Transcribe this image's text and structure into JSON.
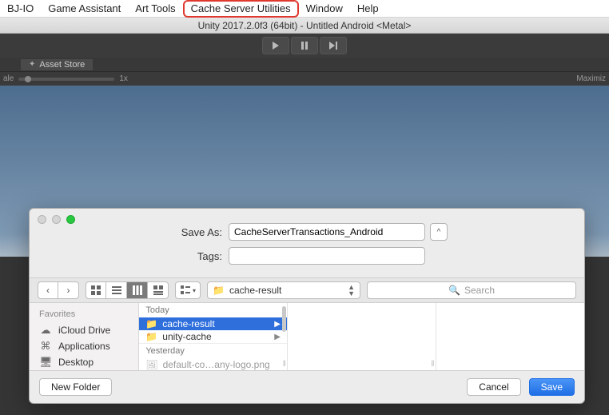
{
  "menubar": {
    "items": [
      "BJ-IO",
      "Game Assistant",
      "Art Tools",
      "Cache Server Utilities",
      "Window",
      "Help"
    ],
    "highlighted_index": 3
  },
  "titlebar": "Unity 2017.2.0f3 (64bit) - Untitled        Android <Metal>",
  "assetstore_tab": "Asset Store",
  "scale": {
    "label_left": "ale",
    "value": "1x",
    "label_right": "Maximiz"
  },
  "save_dialog": {
    "save_as_label": "Save As:",
    "save_as_value": "CacheServerTransactions_Android",
    "tags_label": "Tags:",
    "tags_value": "",
    "expand_caret": "^",
    "path_selector": "cache-result",
    "search_placeholder": "Search",
    "sidebar": {
      "header": "Favorites",
      "items": [
        {
          "icon": "cloud",
          "label": "iCloud Drive"
        },
        {
          "icon": "apps",
          "label": "Applications"
        },
        {
          "icon": "desktop",
          "label": "Desktop"
        }
      ]
    },
    "column1": {
      "groups": [
        {
          "label": "Today",
          "items": [
            {
              "type": "folder",
              "name": "cache-result",
              "selected": true,
              "has_children": true
            },
            {
              "type": "folder",
              "name": "unity-cache",
              "selected": false,
              "has_children": true
            }
          ]
        },
        {
          "label": "Yesterday",
          "items": [
            {
              "type": "file",
              "name": "default-co…any-logo.png",
              "dimmed": true
            }
          ]
        }
      ]
    },
    "footer": {
      "new_folder": "New Folder",
      "cancel": "Cancel",
      "save": "Save"
    }
  }
}
